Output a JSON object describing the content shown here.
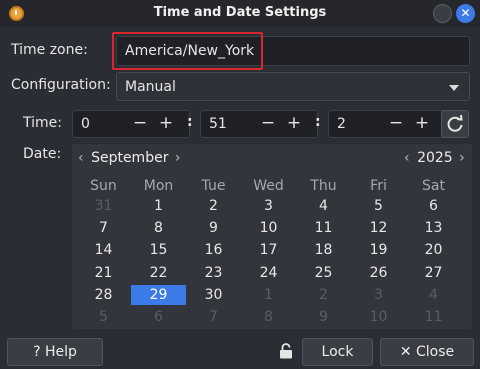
{
  "window": {
    "title": "Time and Date Settings"
  },
  "timezone": {
    "label": "Time zone:",
    "value": "America/New_York"
  },
  "configuration": {
    "label": "Configuration:",
    "value": "Manual"
  },
  "time": {
    "label": "Time:",
    "hours": "0",
    "minutes": "51",
    "seconds": "2",
    "minus": "−",
    "plus": "+",
    "separator": ":"
  },
  "date": {
    "label": "Date:",
    "month": "September",
    "year": "2025",
    "weekdays": [
      "Sun",
      "Mon",
      "Tue",
      "Wed",
      "Thu",
      "Fri",
      "Sat"
    ],
    "weeks": [
      [
        "31",
        "1",
        "2",
        "3",
        "4",
        "5",
        "6"
      ],
      [
        "7",
        "8",
        "9",
        "10",
        "11",
        "12",
        "13"
      ],
      [
        "14",
        "15",
        "16",
        "17",
        "18",
        "19",
        "20"
      ],
      [
        "21",
        "22",
        "23",
        "24",
        "25",
        "26",
        "27"
      ],
      [
        "28",
        "29",
        "30",
        "1",
        "2",
        "3",
        "4"
      ],
      [
        "5",
        "6",
        "7",
        "8",
        "9",
        "10",
        "11"
      ]
    ],
    "selected_day": "29",
    "accent_color": "#3b7be8"
  },
  "buttons": {
    "help": "? Help",
    "lock": "Lock",
    "close": "✕ Close"
  },
  "icons": {
    "app": "clock-icon",
    "refresh": "refresh-icon",
    "lock": "lock-icon"
  }
}
